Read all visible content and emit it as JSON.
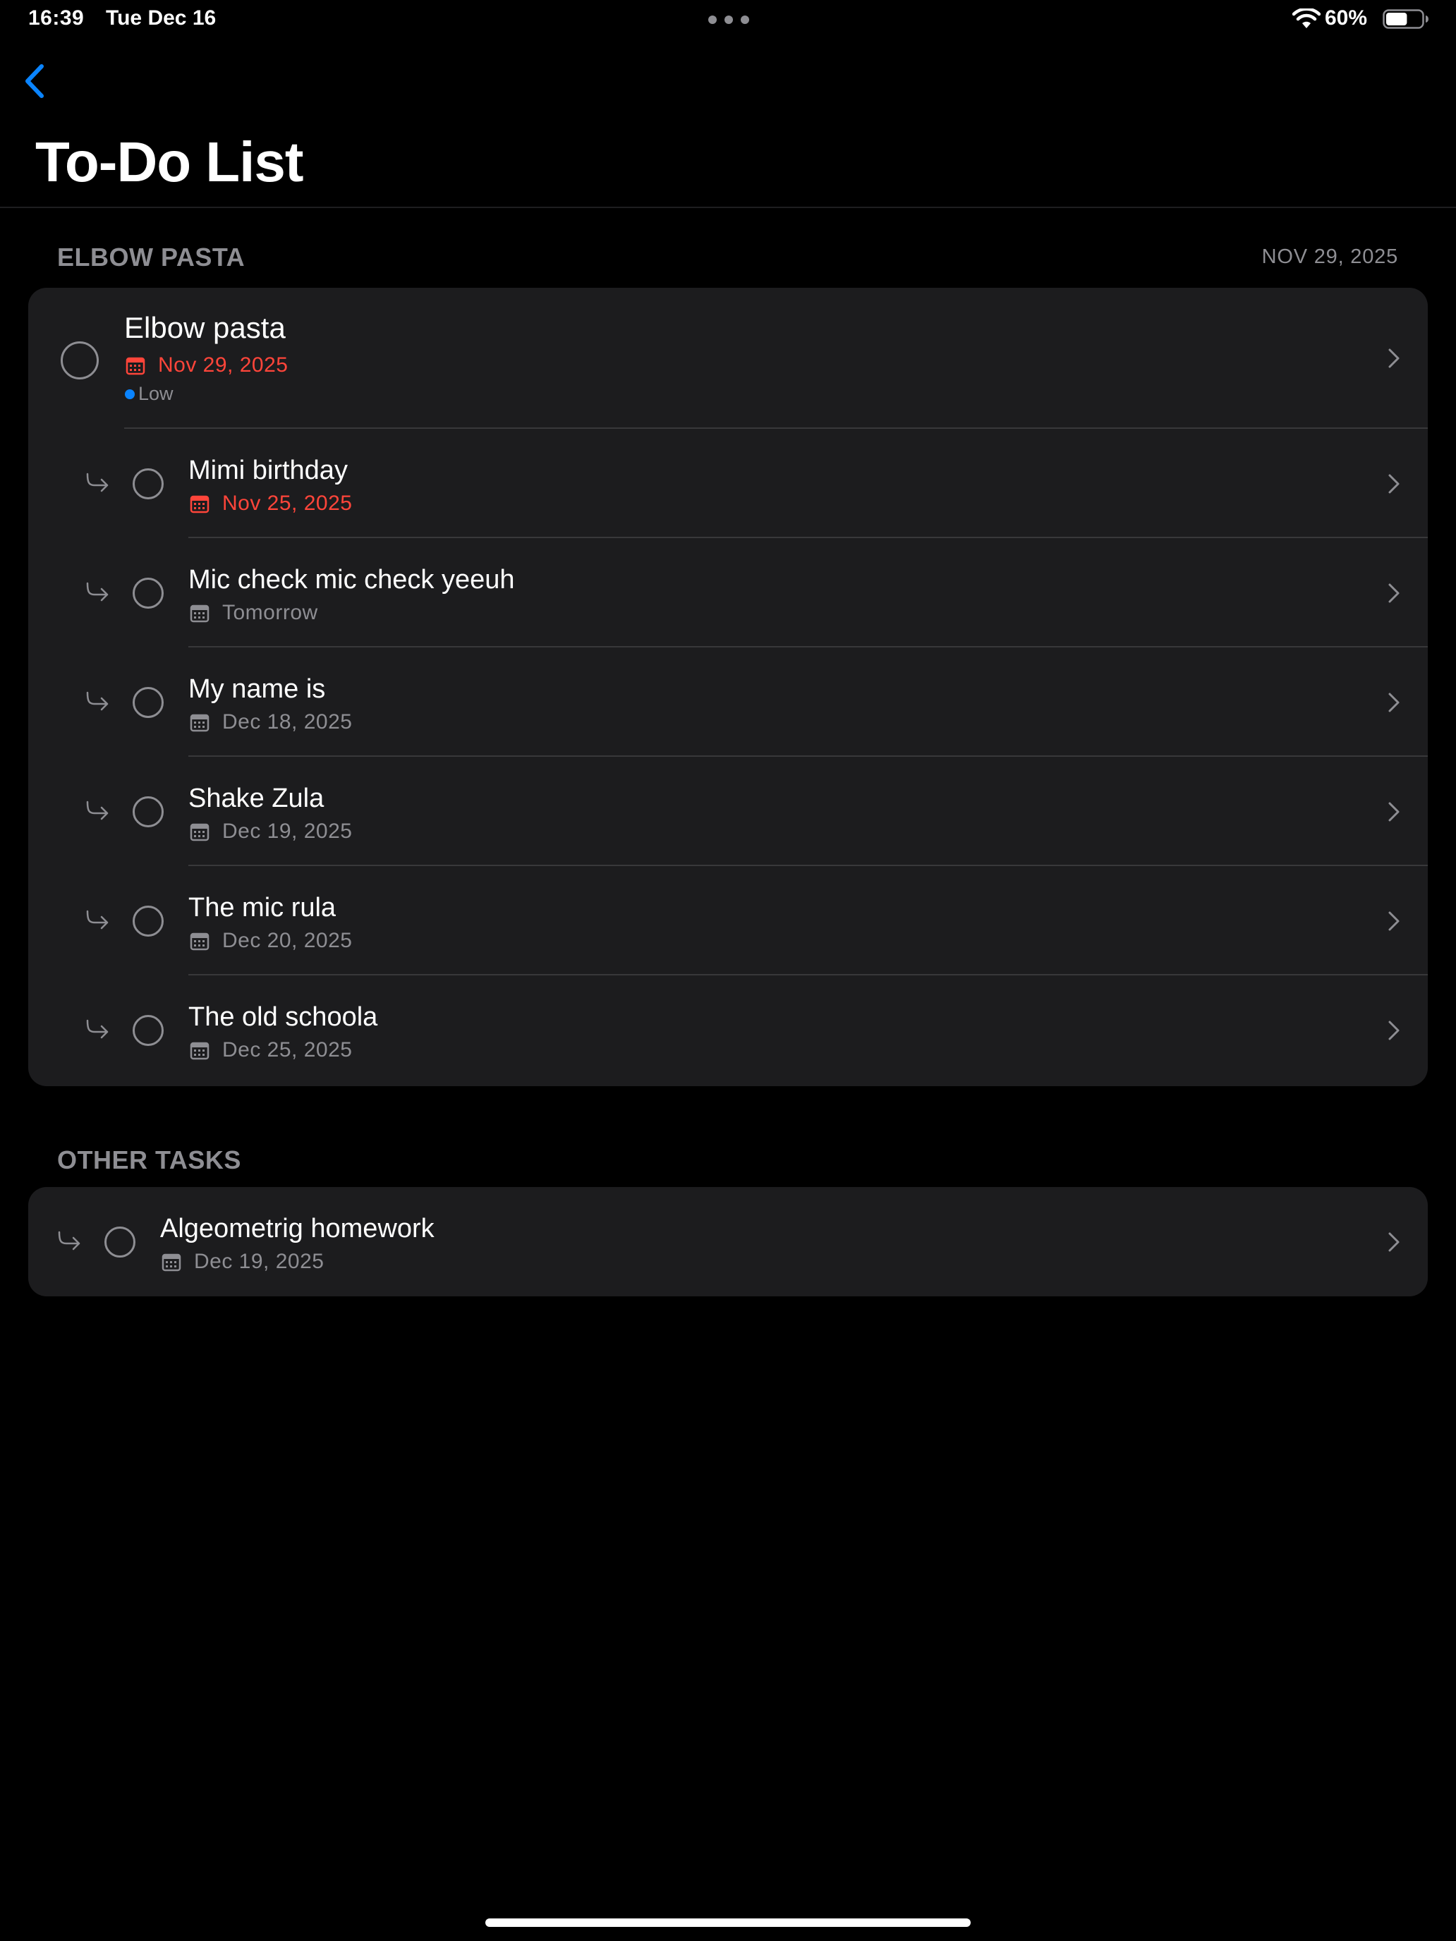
{
  "status_bar": {
    "time": "16:39",
    "date": "Tue Dec 16",
    "battery": "60%",
    "battery_level": 0.6
  },
  "nav": {
    "title": "To-Do List",
    "accent_color": "#0a84ff"
  },
  "sections": [
    {
      "header": "ELBOW PASTA",
      "date": "NOV 29, 2025",
      "parent": {
        "title": "Elbow pasta",
        "date": "Nov 29, 2025",
        "overdue": true,
        "priority": "Low",
        "priority_color": "#0a84ff"
      },
      "subtasks": [
        {
          "title": "Mimi birthday",
          "date": "Nov 25, 2025",
          "overdue": true
        },
        {
          "title": "Mic check mic check yeeuh",
          "date": "Tomorrow",
          "overdue": false
        },
        {
          "title": "My name is",
          "date": "Dec 18, 2025",
          "overdue": false
        },
        {
          "title": "Shake Zula",
          "date": "Dec 19, 2025",
          "overdue": false
        },
        {
          "title": "The mic rula",
          "date": "Dec 20, 2025",
          "overdue": false
        },
        {
          "title": "The old schoola",
          "date": "Dec 25, 2025",
          "overdue": false
        }
      ]
    },
    {
      "header": "OTHER TASKS",
      "tasks": [
        {
          "title": "Algeometrig homework",
          "date": "Dec 19, 2025",
          "overdue": false
        }
      ]
    }
  ],
  "icons": {
    "back": "chevron-left-icon",
    "checkbox": "circle-icon",
    "subtask": "subtask-arrow-icon",
    "calendar": "calendar-icon",
    "disclosure": "chevron-right-icon"
  },
  "colors": {
    "background": "#000000",
    "card": "#1c1c1e",
    "secondary_text": "#8e8e93",
    "overdue": "#ff453a",
    "priority_low": "#0a84ff"
  }
}
